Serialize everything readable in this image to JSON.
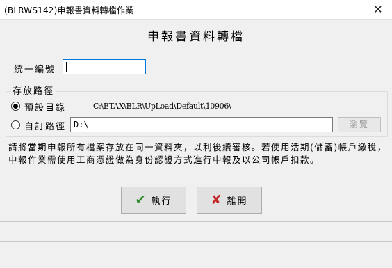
{
  "window": {
    "title": "(BLRWS142)申報書資料轉檔作業",
    "close_symbol": "✕"
  },
  "heading": "申報書資料轉檔",
  "form": {
    "unified_id_label": "統一編號",
    "unified_id_value": ""
  },
  "storage": {
    "caption": "存放路徑",
    "default_option_label": "預設目錄",
    "default_path": "C:\\ETAX\\BLR\\UpLoad\\Default\\10906\\",
    "custom_option_label": "自訂路徑",
    "custom_path_value": "D:\\",
    "browse_label": "瀏覽",
    "selected": "default"
  },
  "notice": "請將當期申報所有檔案存放在同一資料夾，以利後續審核。若使用活期(儲蓄)帳戶繳稅，申報作業需使用工商憑證做為身份認證方式進行申報及以公司帳戶扣款。",
  "buttons": {
    "execute_label": "執行",
    "leave_label": "離開"
  },
  "icons": {
    "execute": "checkmark-icon",
    "leave": "x-icon"
  },
  "colors": {
    "check_green": "#2f8a2f",
    "x_red": "#c62828",
    "focus_blue": "#0078d7"
  }
}
